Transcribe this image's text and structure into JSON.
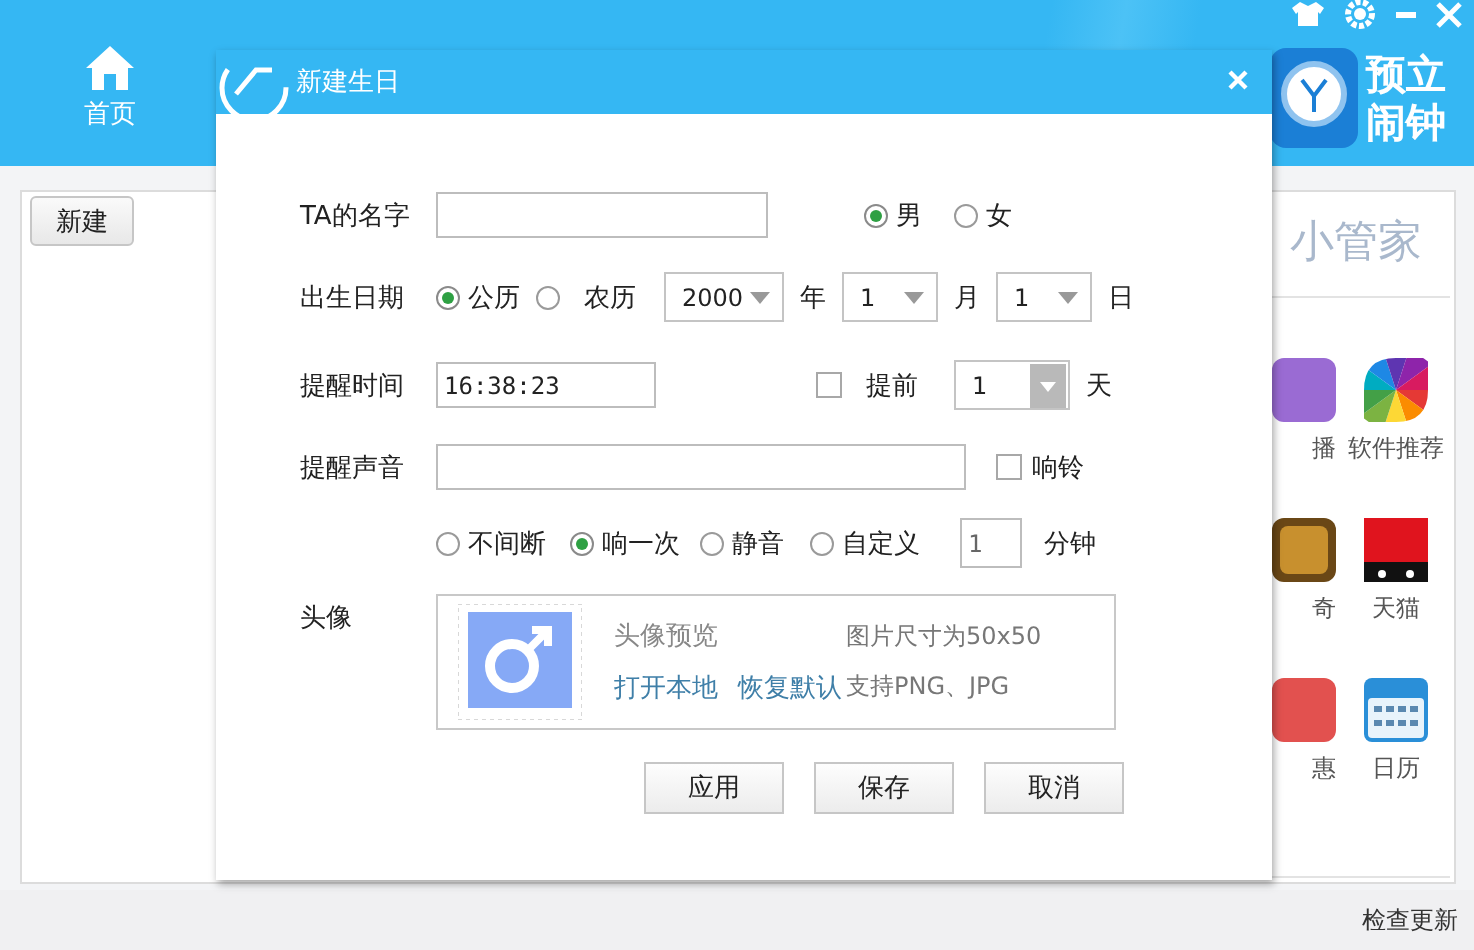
{
  "header": {
    "nav": [
      {
        "label": "首页"
      }
    ],
    "logo": [
      "预立",
      "闹钟"
    ]
  },
  "toolbar": {
    "buttons": [
      "新建"
    ]
  },
  "panel": {
    "title": "小管家",
    "apps": [
      {
        "label": "播",
        "kind": "video"
      },
      {
        "label": "软件推荐",
        "kind": "wheel"
      },
      {
        "label": "奇",
        "kind": "game"
      },
      {
        "label": "天猫",
        "kind": "shop"
      },
      {
        "label": "惠",
        "kind": "deal"
      },
      {
        "label": "日历",
        "kind": "calendar"
      }
    ]
  },
  "status_bar": {
    "link": "检查更新"
  },
  "dialog": {
    "title": "新建生日",
    "name": {
      "label": "TA的名字"
    },
    "gender": [
      {
        "label": "男",
        "selected": true
      },
      {
        "label": "女",
        "selected": false
      }
    ],
    "birth": {
      "label": "出生日期",
      "calendar": [
        {
          "label": "公历",
          "selected": true
        },
        {
          "label": "农历",
          "selected": false
        }
      ],
      "fields": [
        {
          "value": "2000",
          "unit": "年"
        },
        {
          "value": "1",
          "unit": "月"
        },
        {
          "value": "1",
          "unit": "日"
        }
      ]
    },
    "time": {
      "label": "提醒时间",
      "value": "16:38:23",
      "advance": {
        "label": "提前",
        "checked": false,
        "value": "1",
        "unit": "天"
      }
    },
    "sound": {
      "label": "提醒声音",
      "ring": {
        "label": "响铃",
        "checked": false
      },
      "modes": [
        {
          "label": "不间断",
          "selected": false
        },
        {
          "label": "响一次",
          "selected": true
        },
        {
          "label": "静音",
          "selected": false
        },
        {
          "label": "自定义",
          "selected": false
        }
      ],
      "minutes": {
        "value": "1",
        "unit": "分钟"
      }
    },
    "avatar": {
      "label": "头像",
      "preview": "头像预览",
      "links": [
        "打开本地",
        "恢复默认"
      ],
      "notes": [
        "图片尺寸为50x50",
        "支持PNG、JPG"
      ]
    },
    "buttons": [
      "应用",
      "保存",
      "取消"
    ]
  }
}
